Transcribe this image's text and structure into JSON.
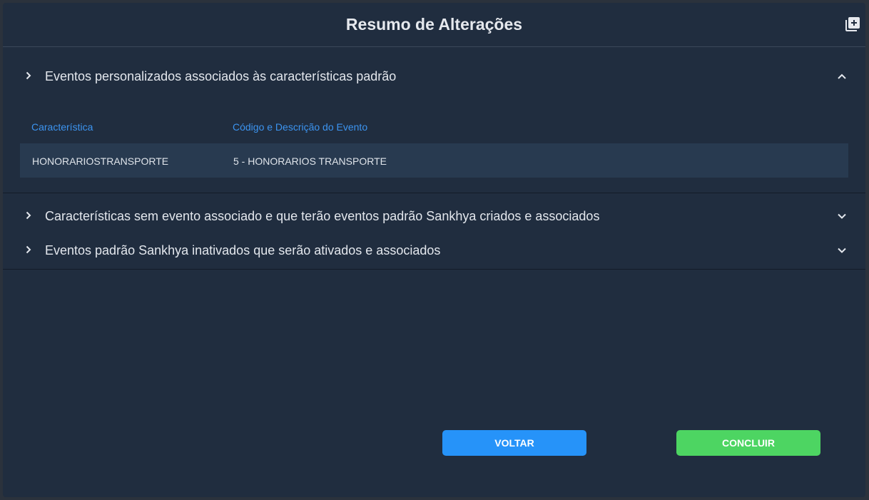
{
  "dialog": {
    "title": "Resumo de Alterações",
    "header_icon": "add-to-collection-icon"
  },
  "sections": [
    {
      "title": "Eventos personalizados associados às características padrão",
      "expanded": true,
      "table": {
        "columns": [
          "Característica",
          "Código e Descrição do Evento"
        ],
        "rows": [
          [
            "HONORARIOSTRANSPORTE",
            "5 - HONORARIOS TRANSPORTE"
          ]
        ]
      }
    },
    {
      "title": "Características sem evento associado e que terão eventos padrão Sankhya criados e associados",
      "expanded": false
    },
    {
      "title": "Eventos padrão Sankhya inativados que serão ativados e associados",
      "expanded": false
    }
  ],
  "buttons": {
    "back": "VOLTAR",
    "finish": "CONCLUIR"
  },
  "colors": {
    "background": "#202d3f",
    "accent_link": "#3c94f0",
    "back_button": "#2693f9",
    "finish_button": "#4dd562"
  }
}
